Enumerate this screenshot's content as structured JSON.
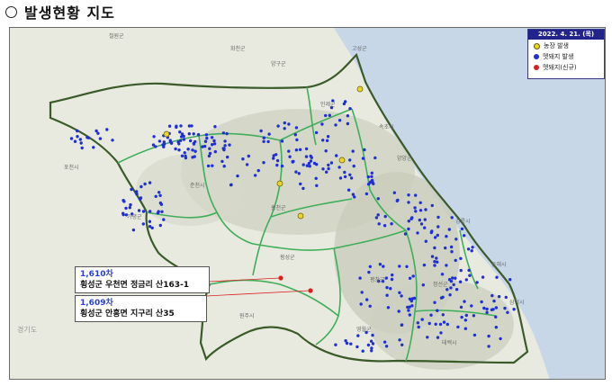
{
  "header": {
    "title": "발생현황 지도"
  },
  "legend": {
    "date": "2022. 4. 21. (목)",
    "items": [
      {
        "key": "farm",
        "label": "농장 발생",
        "color": "#e8d628"
      },
      {
        "key": "boar",
        "label": "멧돼지 발생",
        "color": "#1f2fd6"
      },
      {
        "key": "new",
        "label": "멧돼지(신규)",
        "color": "#d92020"
      }
    ]
  },
  "callouts": [
    {
      "number": "1,610차",
      "address": "횡성군 우천면 정금리 산163-1"
    },
    {
      "number": "1,609차",
      "address": "횡성군 안흥면 지구리 산35"
    }
  ],
  "places": [
    "철원군",
    "화천군",
    "양구군",
    "인제군",
    "고성군",
    "속초시",
    "양양군",
    "춘천시",
    "홍천군",
    "강릉시",
    "횡성군",
    "원주시",
    "평창군",
    "정선군",
    "동해시",
    "삼척시",
    "영월군",
    "태백시",
    "가평군",
    "포천시",
    "경기도"
  ],
  "colors": {
    "boar_dot": "#1f2fd6",
    "new_dot": "#d92020",
    "farm_dot": "#e8d628",
    "border_line": "#3fae5a",
    "province_line": "#3b5a2a",
    "sea": "#c7d7e8"
  }
}
